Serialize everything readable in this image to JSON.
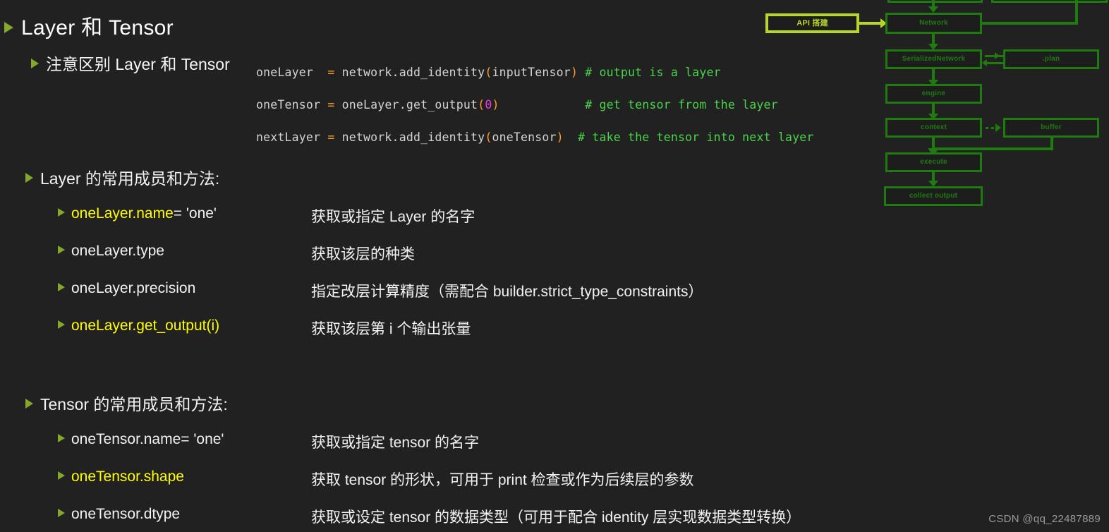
{
  "slide": {
    "title": "Layer 和 Tensor",
    "subtitle": "注意区别 Layer 和 Tensor",
    "layer_section_heading": "Layer 的常用成员和方法:",
    "tensor_section_heading": "Tensor 的常用成员和方法:",
    "background_color": "#212121",
    "bullet_color": "#84a82b",
    "highlight_color": "#ffff00",
    "text_color": "#f2f2f2"
  },
  "code": {
    "lines": [
      {
        "var": "oneLayer ",
        "op": " = ",
        "call_head": "network.add_identity",
        "open": "(",
        "arg": "inputTensor",
        "close": ")",
        "gap": " ",
        "comment": "# output is a layer"
      },
      {
        "var": "oneTensor",
        "op": " = ",
        "call_head": "oneLayer.get_output",
        "open": "(",
        "arg": "0",
        "arg_is_number": true,
        "close": ")",
        "gap": "            ",
        "comment": "# get tensor from the layer"
      },
      {
        "var": "nextLayer",
        "op": " = ",
        "call_head": "network.add_identity",
        "open": "(",
        "arg": "oneTensor",
        "close": ")",
        "gap": "  ",
        "comment": "# take the tensor into next layer"
      }
    ],
    "colors": {
      "identifier": "#d4d4d4",
      "operator": "#ff9b2b",
      "punctuation": "#ff9b2b",
      "number": "#e83ee8",
      "comment": "#4bd44b"
    }
  },
  "layer_members": [
    {
      "name": "oneLayer.name",
      "suffix": " = 'one'",
      "highlight": true,
      "desc": "获取或指定 Layer 的名字"
    },
    {
      "name": "oneLayer.type",
      "suffix": "",
      "highlight": false,
      "desc": "获取该层的种类"
    },
    {
      "name": "oneLayer.precision",
      "suffix": "",
      "highlight": false,
      "desc": "指定改层计算精度（需配合 builder.strict_type_constraints）"
    },
    {
      "name": "oneLayer.get_output(i)",
      "suffix": "",
      "highlight": true,
      "desc": "获取该层第 i 个输出张量"
    }
  ],
  "tensor_members": [
    {
      "name": "oneTensor.name",
      "suffix": " = 'one'",
      "highlight": false,
      "desc": "获取或指定 tensor 的名字"
    },
    {
      "name": "oneTensor.shape",
      "suffix": "",
      "highlight": true,
      "desc": "获取 tensor 的形状，可用于 print 检查或作为后续层的参数"
    },
    {
      "name": "oneTensor.dtype",
      "suffix": "",
      "highlight": false,
      "desc": "获取或设定 tensor 的数据类型（可用于配合 identity 层实现数据类型转换）"
    }
  ],
  "diagram": {
    "boxes": [
      {
        "id": "api",
        "label": "API 搭建",
        "bright": true
      },
      {
        "id": "network",
        "label": "Network",
        "bright": false
      },
      {
        "id": "serial",
        "label": "SerializedNetwork",
        "bright": false
      },
      {
        "id": "plan",
        "label": ".plan",
        "bright": false
      },
      {
        "id": "engine",
        "label": "engine",
        "bright": false
      },
      {
        "id": "context",
        "label": "context",
        "bright": false
      },
      {
        "id": "buffer",
        "label": "buffer",
        "bright": false
      },
      {
        "id": "execute",
        "label": "execute",
        "bright": false
      },
      {
        "id": "collect",
        "label": "collect output",
        "bright": false
      }
    ],
    "edge_color": "#1f7a10",
    "highlight_edge_color": "#b8d62a"
  },
  "watermark": "CSDN @qq_22487889"
}
